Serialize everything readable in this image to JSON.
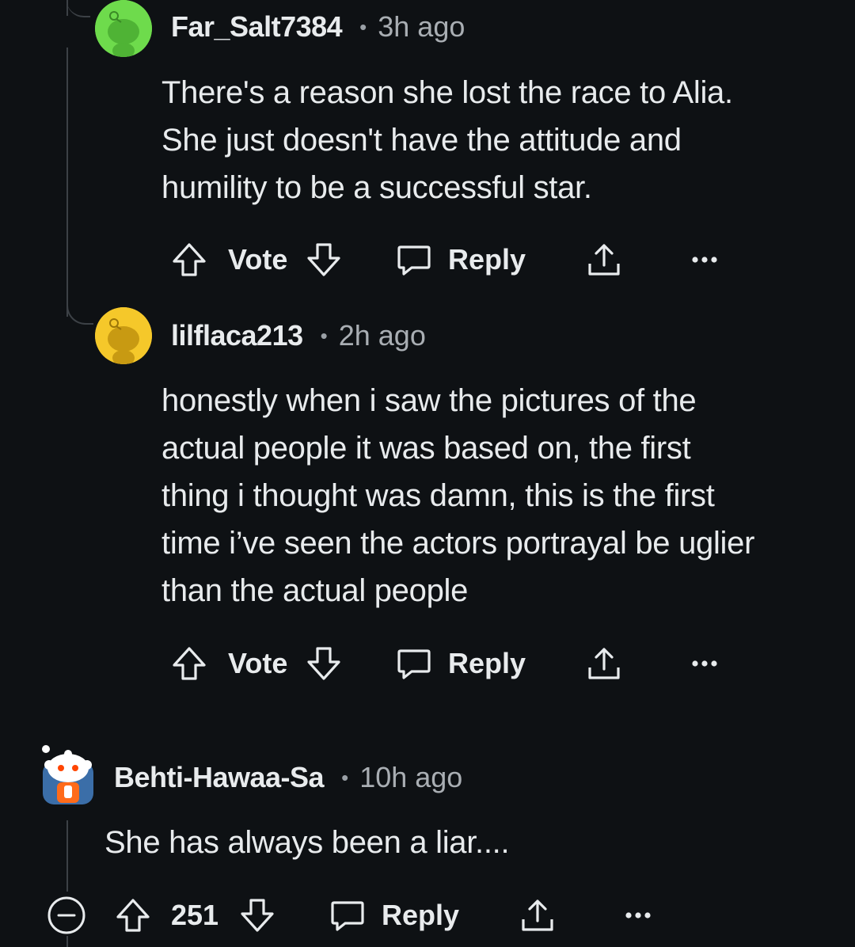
{
  "comments": [
    {
      "username": "Far_Salt7384",
      "separator": "•",
      "time": "3h ago",
      "body_lines": [
        "There's a reason she lost the race to Alia.",
        "She just doesn't have the attitude and",
        "humility to be a successful star."
      ],
      "actions": {
        "vote_label": "Vote",
        "reply_label": "Reply"
      },
      "avatar": {
        "icon": "snoo-avatar-icon",
        "color": "#6edb4c"
      }
    },
    {
      "username": "lilflaca213",
      "separator": "•",
      "time": "2h ago",
      "body_lines": [
        "honestly when i saw the pictures of the",
        "actual people it was based on, the first",
        "thing i thought was damn, this is the first",
        "time i’ve seen the actors portrayal be uglier",
        "than the actual people"
      ],
      "actions": {
        "vote_label": "Vote",
        "reply_label": "Reply"
      },
      "avatar": {
        "icon": "snoo-avatar-icon",
        "color": "#f5c82a"
      }
    },
    {
      "username": "Behti-Hawaa-Sa",
      "separator": "•",
      "time": "10h ago",
      "body_lines": [
        "She has always been a liar...."
      ],
      "actions": {
        "score": "251",
        "reply_label": "Reply"
      },
      "avatar": {
        "icon": "snoo-custom-avatar-icon"
      }
    }
  ],
  "colors": {
    "background": "#0e1114",
    "text": "#e8ebed",
    "muted": "#a9aeb3",
    "thread_line": "#3c4146"
  }
}
